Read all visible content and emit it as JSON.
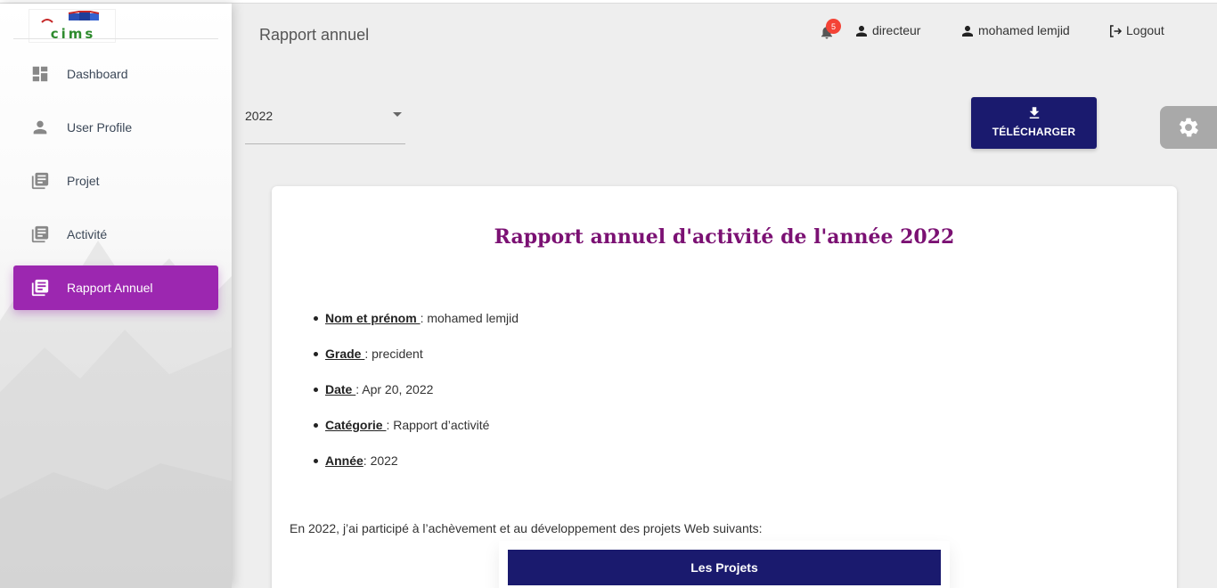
{
  "header": {
    "page_title": "Rapport annuel",
    "notification_count": "5",
    "role_label": "directeur",
    "user_name": "mohamed lemjid",
    "logout_label": "Logout"
  },
  "sidebar": {
    "logo_text": "cims",
    "items": [
      {
        "label": "Dashboard",
        "icon": "dashboard-icon"
      },
      {
        "label": "User Profile",
        "icon": "person-icon"
      },
      {
        "label": "Projet",
        "icon": "library-books-icon"
      },
      {
        "label": "Activité",
        "icon": "library-books-icon"
      },
      {
        "label": "Rapport Annuel",
        "icon": "library-books-icon",
        "active": true
      }
    ],
    "accent": "#9c27b0"
  },
  "filters": {
    "year_value": "2022"
  },
  "toolbar": {
    "download_label": "TÉLÉCHARGER"
  },
  "report": {
    "title": "Rapport annuel d'activité de l'année 2022",
    "fields": [
      {
        "key": "Nom et prénom ",
        "value": " : mohamed lemjid"
      },
      {
        "key": "Grade ",
        "value": " : precident"
      },
      {
        "key": "Date ",
        "value": " : Apr 20, 2022"
      },
      {
        "key": "Catégorie ",
        "value": " : Rapport d’activité"
      },
      {
        "key": "Année",
        "value": ": 2022"
      }
    ],
    "intro": "En 2022, j’ai participé à l’achèvement et au développement des projets Web suivants:",
    "projects_header": "Les Projets"
  },
  "colors": {
    "primary_dark": "#1a1a6e",
    "title_purple": "#7b1173",
    "badge_red": "#f44336"
  }
}
